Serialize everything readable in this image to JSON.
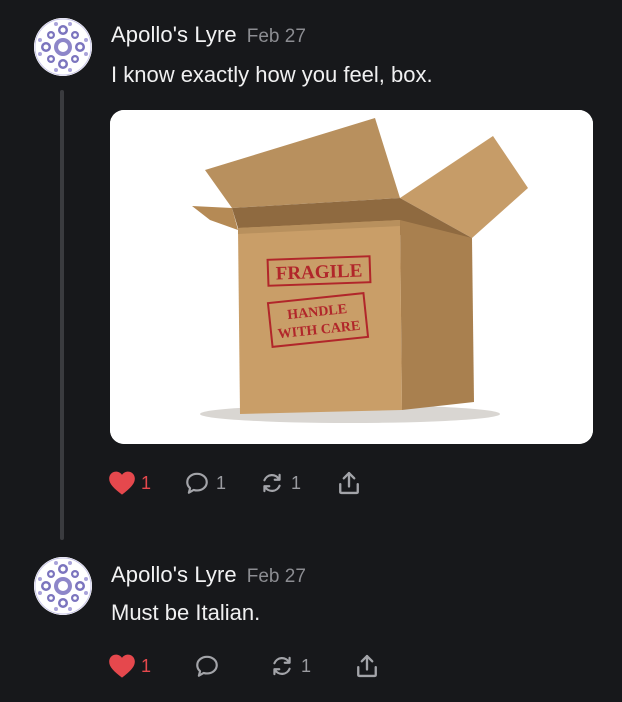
{
  "posts": [
    {
      "author": "Apollo's Lyre",
      "date": "Feb 27",
      "text": "I know exactly how you feel, box.",
      "image": {
        "stamp_fragile": "FRAGILE",
        "stamp_handle_line1": "HANDLE",
        "stamp_handle_line2": "WITH CARE"
      },
      "actions": {
        "likes": "1",
        "liked": true,
        "comments": "1",
        "restacks": "1"
      }
    },
    {
      "author": "Apollo's Lyre",
      "date": "Feb 27",
      "text": "Must be Italian.",
      "actions": {
        "likes": "1",
        "liked": true,
        "comments": "",
        "restacks": "1"
      }
    }
  ],
  "colors": {
    "background": "#17181b",
    "like_red": "#e5484d",
    "muted": "#8c8d92",
    "thread_line": "#3a3b3f"
  },
  "icons": [
    "heart-icon",
    "comment-icon",
    "restack-icon",
    "share-icon"
  ]
}
